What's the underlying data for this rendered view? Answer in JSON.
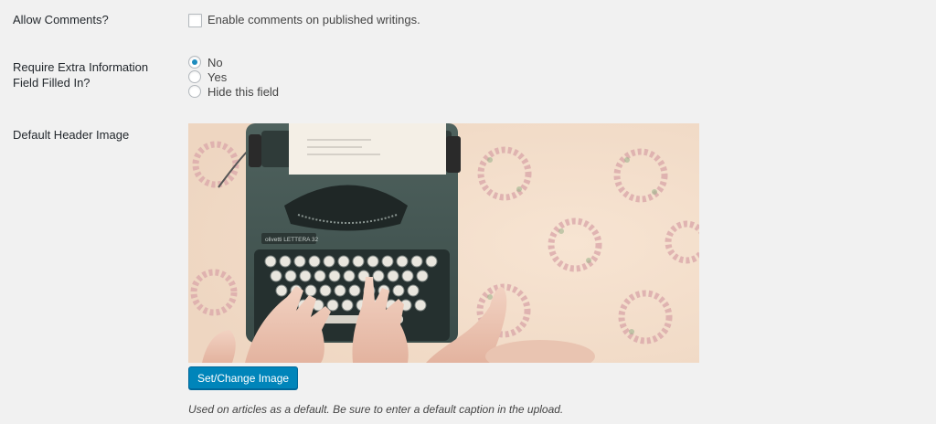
{
  "allow_comments": {
    "label": "Allow Comments?",
    "checkbox_text": "Enable comments on published writings.",
    "checked": false
  },
  "extra_info": {
    "label": "Require Extra Information Field Filled In?",
    "options": [
      {
        "label": "No",
        "checked": true
      },
      {
        "label": "Yes",
        "checked": false
      },
      {
        "label": "Hide this field",
        "checked": false
      }
    ]
  },
  "header_image": {
    "label": "Default Header Image",
    "button_label": "Set/Change Image",
    "description": "Used on articles as a default. Be sure to enter a default caption in the upload.",
    "typewriter_brand": "olivetti LETTERA 32"
  },
  "colors": {
    "background": "#f1f1f1",
    "button": "#0085ba",
    "radio_dot": "#1e8cbe"
  }
}
